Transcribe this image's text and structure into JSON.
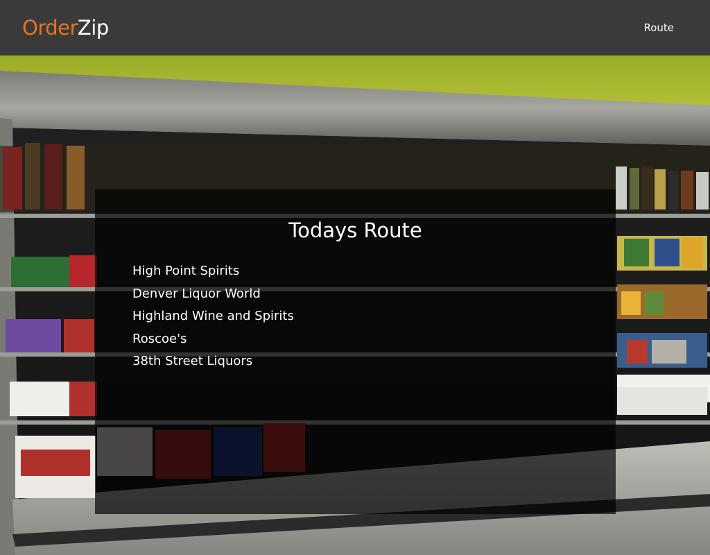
{
  "navbar": {
    "brand_part1": "Order",
    "brand_part2": "Zip",
    "link_route": "Route"
  },
  "route": {
    "title": "Todays Route",
    "stops": [
      "High Point Spirits",
      "Denver Liquor World",
      "Highland Wine and Spirits",
      "Roscoe's",
      "38th Street Liquors"
    ]
  },
  "colors": {
    "navbar_bg": "#3a3a3a",
    "brand_accent": "#e8741f",
    "panel_overlay": "rgba(0,0,0,0.68)"
  }
}
